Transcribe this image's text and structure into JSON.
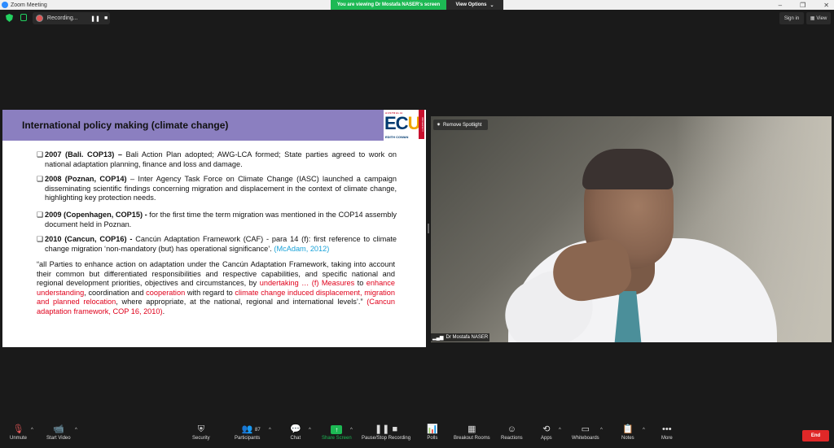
{
  "window": {
    "title": "Zoom Meeting",
    "controls": [
      "–",
      "❐",
      "✕"
    ]
  },
  "banner": {
    "viewing_text": "You are viewing Dr Mostafa NASER's screen",
    "view_options": "View Options",
    "view_options_caret": "⌄"
  },
  "topbar": {
    "recording_label": "Recording...",
    "pause_glyph": "❚❚",
    "stop_glyph": "■",
    "sign_in": "Sign in",
    "view": "View"
  },
  "slide": {
    "title": "International policy making (climate change)",
    "logo": {
      "australia": "AUSTRALIA",
      "ecu_ec": "EC",
      "ecu_u": "U",
      "edith": "EDITH COWAN",
      "university": "UNIVERSITY"
    },
    "bullet_mark": "❑",
    "bullets": [
      {
        "bold": "2007 (Bali. COP13) –",
        "text": " Bali Action Plan adopted; AWG-LCA formed; State parties agreed to work on national adaptation planning, finance and loss and damage."
      },
      {
        "bold": "2008 (Poznan, COP14)",
        "text": " – Inter Agency Task Force on Climate Change (IASC) launched a campaign disseminating scientific findings concerning migration and displacement in the context of climate change, highlighting key protection needs."
      },
      {
        "bold": "2009 (Copenhagen, COP15) -",
        "text": "  for the first time the term migration was mentioned in the COP14 assembly document held in Poznan."
      },
      {
        "bold": "2010 (Cancun, COP16) -",
        "text": " Cancún Adaptation Framework (CAF) - para 14 (f): first reference to climate change migration ‘non-mandatory (but) has operational significance’. ",
        "cite": "(McAdam, 2012)"
      }
    ],
    "quote": {
      "p1": "“all Parties to enhance action on adaptation under the Cancún Adaptation Framework, taking into account their common but differentiated responsibilities and respective capabilities, and specific national and regional development priorities, objectives and circumstances, by ",
      "r1": "undertaking … (f) Measures",
      "p2": " to ",
      "r2": "enhance understanding",
      "p3": ", coordination and ",
      "r3": "cooperation",
      "p4": " with regard to ",
      "r4": "climate change induced displacement, migration and planned relocation",
      "p5": ", where appropriate, at the national, regional and international levels’.” ",
      "r5": "(Cancun adaptation framework, COP 16, 2010)",
      "p6": "."
    }
  },
  "video": {
    "remove_spotlight": "Remove Spotlight",
    "spotlight_glyph": "✷",
    "participant_name": "Dr Mostafa NASER",
    "signal_glyph": "▂▄▆"
  },
  "toolbar": {
    "caret": "^",
    "participants_count": "87",
    "items": {
      "unmute": {
        "label": "Unmute",
        "icon": "microphone-muted-icon",
        "glyph": "🎙"
      },
      "start_video": {
        "label": "Start Video",
        "icon": "camera-off-icon",
        "glyph": "📹"
      },
      "security": {
        "label": "Security",
        "icon": "shield-icon",
        "glyph": "⛨"
      },
      "participants": {
        "label": "Participants",
        "icon": "people-icon",
        "glyph": "👥"
      },
      "chat": {
        "label": "Chat",
        "icon": "chat-icon",
        "glyph": "💬"
      },
      "share_screen": {
        "label": "Share Screen",
        "icon": "share-arrow-icon",
        "glyph": "↑"
      },
      "record": {
        "label": "Pause/Stop Recording",
        "icon": "pause-stop-icon",
        "glyph": "❚❚ ■"
      },
      "polls": {
        "label": "Polls",
        "icon": "bar-chart-icon",
        "glyph": "📊"
      },
      "breakout": {
        "label": "Breakout Rooms",
        "icon": "grid-icon",
        "glyph": "▦"
      },
      "reactions": {
        "label": "Reactions",
        "icon": "smile-icon",
        "glyph": "☺"
      },
      "apps": {
        "label": "Apps",
        "icon": "apps-icon",
        "glyph": "⟲"
      },
      "whiteboards": {
        "label": "Whiteboards",
        "icon": "whiteboard-icon",
        "glyph": "▭"
      },
      "notes": {
        "label": "Notes",
        "icon": "notes-icon",
        "glyph": "📋"
      },
      "more": {
        "label": "More",
        "icon": "more-icon",
        "glyph": "•••"
      }
    },
    "end": "End"
  },
  "colors": {
    "banner_green": "#1db954",
    "slide_header": "#8b7fc0",
    "highlight_red": "#e0001b",
    "cite_cyan": "#1aa3d9",
    "end_red": "#e02828"
  }
}
